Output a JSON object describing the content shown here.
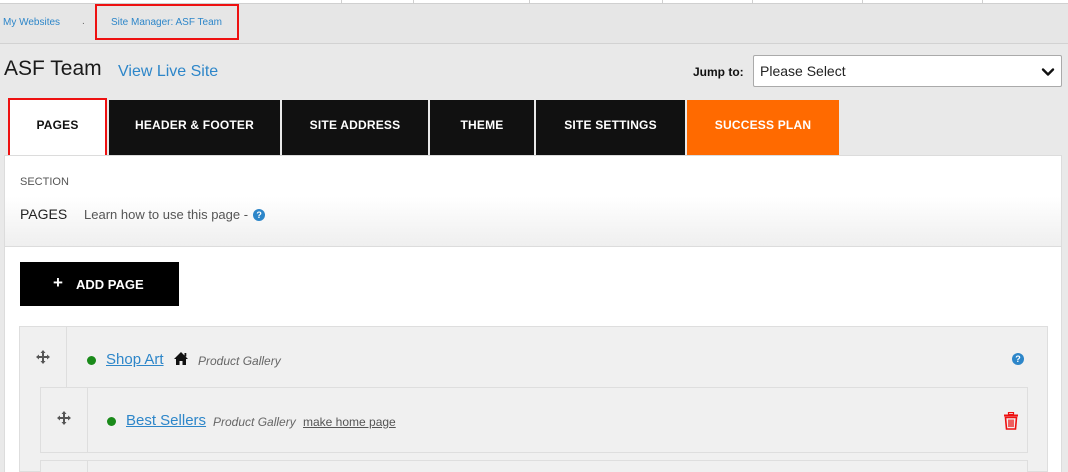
{
  "breadcrumb": {
    "root": "My Websites",
    "separator": ".",
    "current": "Site Manager: ASF Team"
  },
  "header": {
    "site_title": "ASF Team",
    "view_live": "View Live Site",
    "jump_label": "Jump to:",
    "jump_value": "Please Select"
  },
  "tabs": [
    {
      "label": "PAGES",
      "active": true
    },
    {
      "label": "HEADER & FOOTER"
    },
    {
      "label": "SITE ADDRESS"
    },
    {
      "label": "THEME"
    },
    {
      "label": "SITE SETTINGS"
    },
    {
      "label": "SUCCESS PLAN",
      "accent": "#ff6a00"
    }
  ],
  "section": {
    "label": "SECTION",
    "name": "PAGES",
    "help_text": "Learn how to use this page -"
  },
  "actions": {
    "add_page": "ADD PAGE"
  },
  "pages": [
    {
      "name": "Shop Art",
      "type": "Product Gallery",
      "is_home": true,
      "status_color": "#1a8a1a"
    },
    {
      "name": "Best Sellers",
      "type": "Product Gallery",
      "make_home": "make home page",
      "status_color": "#1a8a1a"
    }
  ],
  "icons": [
    "move-icon",
    "home-icon",
    "help-icon",
    "trash-icon",
    "chevron-down-icon",
    "plus-icon"
  ]
}
